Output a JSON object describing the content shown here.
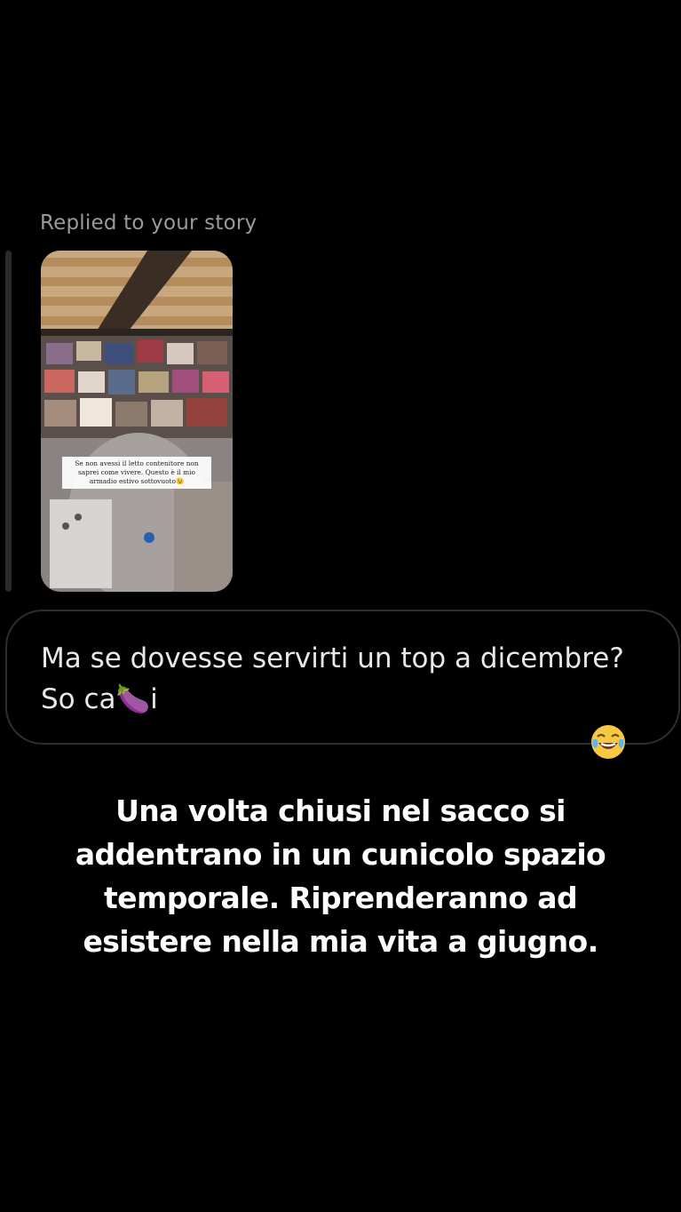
{
  "story_reply": {
    "label": "Replied to your story",
    "thumbnail_caption": "Se non avessi il letto contenitore non saprei come vivere. Questo è il mio armadio estivo sottovuoto😉"
  },
  "message": {
    "text": "Ma se dovesse servirti un top a dicembre?\nSo ca🍆i",
    "reaction": "😂"
  },
  "caption": {
    "text": "Una volta chiusi nel sacco si addentrano in un cunicolo spazio temporale. Riprenderanno ad esistere nella mia vita a giugno."
  }
}
